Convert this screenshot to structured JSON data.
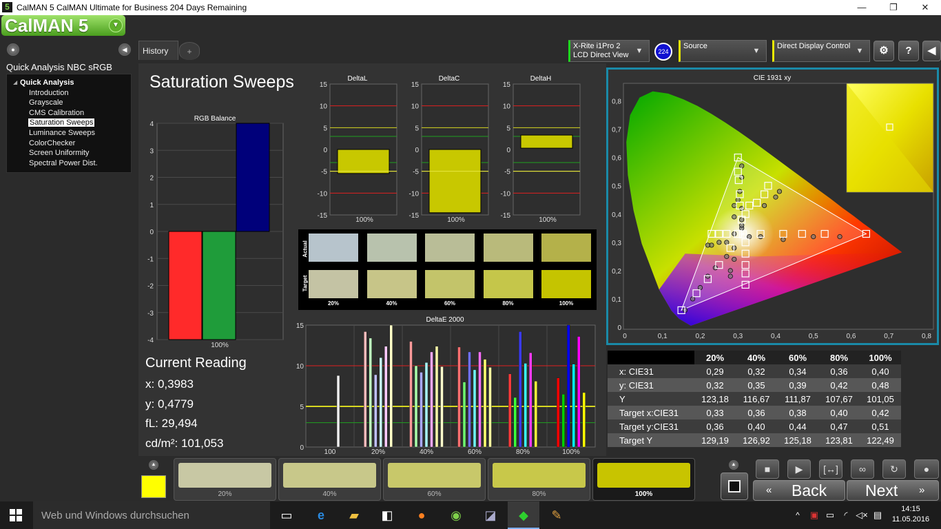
{
  "window": {
    "title": "CalMAN 5 CalMAN Ultimate for Business 204 Days Remaining",
    "app_icon": "5",
    "min": "—",
    "max": "❐",
    "close": "✕"
  },
  "logo": {
    "text": "CalMAN 5"
  },
  "sidebar": {
    "workflow_title": "Quick Analysis NBC sRGB",
    "group": "Quick Analysis",
    "items": [
      {
        "label": "Introduction"
      },
      {
        "label": "Grayscale"
      },
      {
        "label": "CMS Calibration"
      },
      {
        "label": "Saturation Sweeps",
        "selected": true
      },
      {
        "label": "Luminance Sweeps"
      },
      {
        "label": "ColorChecker"
      },
      {
        "label": "Screen Uniformity"
      },
      {
        "label": "Spectral Power Dist."
      }
    ]
  },
  "tabs": {
    "history": "History 1",
    "add": "+"
  },
  "devices": {
    "meter_line1": "X-Rite i1Pro 2",
    "meter_line2": "LCD Direct View",
    "meter_badge": "224",
    "source": "Source",
    "display": "Direct Display Control"
  },
  "page": {
    "title": "Saturation Sweeps"
  },
  "current_reading": {
    "heading": "Current Reading",
    "x": "x: 0,3983",
    "y": "y: 0,4779",
    "fl": "fL: 29,494",
    "cdm2": "cd/m²: 101,053"
  },
  "chart_data": [
    {
      "type": "bar",
      "title": "RGB Balance",
      "categories": [
        "100%"
      ],
      "series": [
        {
          "name": "R",
          "color": "#ff2a2a",
          "values": [
            -4
          ]
        },
        {
          "name": "G",
          "color": "#1f9c3a",
          "values": [
            -4
          ]
        },
        {
          "name": "B",
          "color": "#00007a",
          "values": [
            4
          ]
        }
      ],
      "ylim": [
        -4,
        4
      ],
      "yticks": [
        4,
        3,
        2,
        1,
        0,
        -1,
        -2,
        -3,
        -4
      ],
      "grid": true
    },
    {
      "type": "bar",
      "title": "DeltaL",
      "categories": [
        "100%"
      ],
      "values": [
        -5.5
      ],
      "ylim": [
        -15,
        15
      ],
      "yticks": [
        15,
        10,
        5,
        0,
        -5,
        -10,
        -15
      ]
    },
    {
      "type": "bar",
      "title": "DeltaC",
      "categories": [
        "100%"
      ],
      "values": [
        -14.5
      ],
      "ylim": [
        -15,
        15
      ],
      "yticks": [
        15,
        10,
        5,
        0,
        -5,
        -10,
        -15
      ]
    },
    {
      "type": "bar",
      "title": "DeltaH",
      "categories": [
        "100%"
      ],
      "values": [
        3.3
      ],
      "value_base": 0.3,
      "ylim": [
        -15,
        15
      ],
      "yticks": [
        15,
        10,
        5,
        0,
        -5,
        -10,
        -15
      ]
    },
    {
      "type": "bar",
      "title": "DeltaE 2000",
      "categories": [
        "100",
        "20%",
        "40%",
        "60%",
        "80%",
        "100%"
      ],
      "ylim": [
        0,
        15
      ],
      "yticks": [
        15,
        10,
        5,
        0
      ],
      "thresholds": {
        "red": 10,
        "yellow": 5,
        "green": 3
      },
      "groups": [
        {
          "values": [
            8.8
          ],
          "colors": [
            "#f0f0f0"
          ]
        },
        {
          "values": [
            14.2,
            13.4,
            8.9,
            11.0,
            12.4,
            15.0
          ],
          "colors": [
            "#ffbcbc",
            "#bfffbf",
            "#c0c0ff",
            "#c8ffff",
            "#ffcaff",
            "#ffffc8"
          ]
        },
        {
          "values": [
            13.0,
            10.0,
            9.2,
            10.4,
            11.7,
            12.4,
            9.9
          ],
          "colors": [
            "#ff9a9a",
            "#aaffaa",
            "#aaaaff",
            "#aaffff",
            "#ffaaff",
            "#ffffaa",
            "#ffffcc"
          ]
        },
        {
          "values": [
            12.3,
            8.0,
            11.7,
            9.5,
            11.7,
            10.8,
            9.8
          ],
          "colors": [
            "#ff7070",
            "#70ff70",
            "#7070ff",
            "#70ffff",
            "#ff70ff",
            "#ffff70",
            "#ffffa0"
          ]
        },
        {
          "values": [
            9.0,
            6.1,
            14.2,
            10.3,
            11.6,
            8.1
          ],
          "colors": [
            "#ff3a3a",
            "#3aff3a",
            "#3a3aff",
            "#3affff",
            "#ff3aff",
            "#ffff3a"
          ]
        },
        {
          "values": [
            8.5,
            6.5,
            15.0,
            10.2,
            13.6,
            6.7
          ],
          "colors": [
            "#ff0000",
            "#00d000",
            "#0000ff",
            "#00ffff",
            "#ff00ff",
            "#ffff00"
          ]
        }
      ]
    },
    {
      "type": "scatter",
      "title": "CIE 1931 xy",
      "xlim": [
        0,
        0.8
      ],
      "ylim": [
        0,
        0.85
      ],
      "xticks": [
        "0",
        "0,1",
        "0,2",
        "0,3",
        "0,4",
        "0,5",
        "0,6",
        "0,7",
        "0,8"
      ],
      "yticks": [
        "0",
        "0,1",
        "0,2",
        "0,3",
        "0,4",
        "0,5",
        "0,6",
        "0,7",
        "0,8"
      ],
      "gamut": [
        [
          0.64,
          0.33
        ],
        [
          0.3,
          0.6
        ],
        [
          0.15,
          0.06
        ]
      ],
      "targets": [
        [
          0.313,
          0.329
        ],
        [
          0.36,
          0.33
        ],
        [
          0.42,
          0.33
        ],
        [
          0.47,
          0.33
        ],
        [
          0.53,
          0.33
        ],
        [
          0.64,
          0.33
        ],
        [
          0.31,
          0.38
        ],
        [
          0.305,
          0.43
        ],
        [
          0.305,
          0.47
        ],
        [
          0.302,
          0.52
        ],
        [
          0.3,
          0.55
        ],
        [
          0.3,
          0.6
        ],
        [
          0.3,
          0.33
        ],
        [
          0.27,
          0.33
        ],
        [
          0.25,
          0.33
        ],
        [
          0.23,
          0.33
        ],
        [
          0.32,
          0.4
        ],
        [
          0.33,
          0.43
        ],
        [
          0.35,
          0.44
        ],
        [
          0.37,
          0.47
        ],
        [
          0.38,
          0.5
        ],
        [
          0.28,
          0.28
        ],
        [
          0.25,
          0.22
        ],
        [
          0.22,
          0.17
        ],
        [
          0.19,
          0.12
        ],
        [
          0.15,
          0.06
        ],
        [
          0.32,
          0.3
        ],
        [
          0.32,
          0.26
        ],
        [
          0.32,
          0.22
        ],
        [
          0.32,
          0.19
        ],
        [
          0.32,
          0.15
        ]
      ],
      "measured": [
        [
          0.31,
          0.35
        ],
        [
          0.33,
          0.32
        ],
        [
          0.36,
          0.32
        ],
        [
          0.42,
          0.31
        ],
        [
          0.5,
          0.32
        ],
        [
          0.57,
          0.32
        ],
        [
          0.31,
          0.38
        ],
        [
          0.31,
          0.42
        ],
        [
          0.305,
          0.48
        ],
        [
          0.31,
          0.53
        ],
        [
          0.31,
          0.57
        ],
        [
          0.29,
          0.33
        ],
        [
          0.27,
          0.3
        ],
        [
          0.25,
          0.3
        ],
        [
          0.23,
          0.29
        ],
        [
          0.22,
          0.29
        ],
        [
          0.31,
          0.36
        ],
        [
          0.29,
          0.43
        ],
        [
          0.3,
          0.45
        ],
        [
          0.29,
          0.39
        ],
        [
          0.37,
          0.43
        ],
        [
          0.4,
          0.46
        ],
        [
          0.41,
          0.48
        ],
        [
          0.27,
          0.25
        ],
        [
          0.24,
          0.21
        ],
        [
          0.22,
          0.18
        ],
        [
          0.2,
          0.14
        ],
        [
          0.18,
          0.1
        ],
        [
          0.16,
          0.06
        ],
        [
          0.29,
          0.28
        ],
        [
          0.29,
          0.24
        ],
        [
          0.28,
          0.2
        ],
        [
          0.28,
          0.18
        ]
      ],
      "inset_target": [
        0.4,
        0.48
      ]
    }
  ],
  "swatches": {
    "actual_label": "Actual",
    "target_label": "Target",
    "labels": [
      "20%",
      "40%",
      "60%",
      "80%",
      "100%"
    ],
    "actual_colors": [
      "#b7c4cc",
      "#b8c2ad",
      "#b9bd97",
      "#b9ba7b",
      "#b4b14a"
    ],
    "target_colors": [
      "#c4c3a4",
      "#c7c588",
      "#c3c46a",
      "#c5c64a",
      "#c5c400"
    ]
  },
  "data_table": {
    "columns": [
      "",
      "20%",
      "40%",
      "60%",
      "80%",
      "100%"
    ],
    "rows": [
      [
        "x: CIE31",
        "0,29",
        "0,32",
        "0,34",
        "0,36",
        "0,40"
      ],
      [
        "y: CIE31",
        "0,32",
        "0,35",
        "0,39",
        "0,42",
        "0,48"
      ],
      [
        "Y",
        "123,18",
        "116,67",
        "111,87",
        "107,67",
        "101,05"
      ],
      [
        "Target x:CIE31",
        "0,33",
        "0,36",
        "0,38",
        "0,40",
        "0,42"
      ],
      [
        "Target y:CIE31",
        "0,36",
        "0,40",
        "0,44",
        "0,47",
        "0,51"
      ],
      [
        "Target Y",
        "129,19",
        "126,92",
        "125,18",
        "123,81",
        "122,49"
      ]
    ]
  },
  "bottom_strip": {
    "current_color": "#ffff00",
    "items": [
      {
        "label": "20%",
        "color": "#c8c8a4"
      },
      {
        "label": "40%",
        "color": "#c8c88a"
      },
      {
        "label": "60%",
        "color": "#c8c86a"
      },
      {
        "label": "80%",
        "color": "#c8c84a"
      },
      {
        "label": "100%",
        "color": "#c8c400",
        "active": true
      }
    ]
  },
  "controls": {
    "back": "Back",
    "next": "Next"
  },
  "taskbar": {
    "search_placeholder": "Web und Windows durchsuchen",
    "time": "14:15",
    "date": "11.05.2016"
  }
}
